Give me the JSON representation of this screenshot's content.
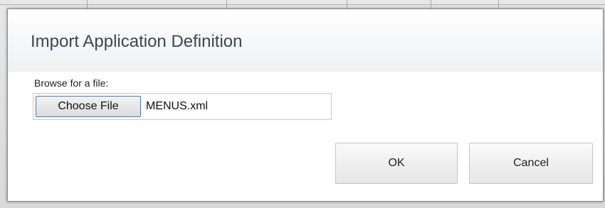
{
  "dialog": {
    "title": "Import Application Definition",
    "browse_label": "Browse for a file:",
    "choose_file_label": "Choose File",
    "selected_file": "MENUS.xml",
    "ok_label": "OK",
    "cancel_label": "Cancel"
  }
}
